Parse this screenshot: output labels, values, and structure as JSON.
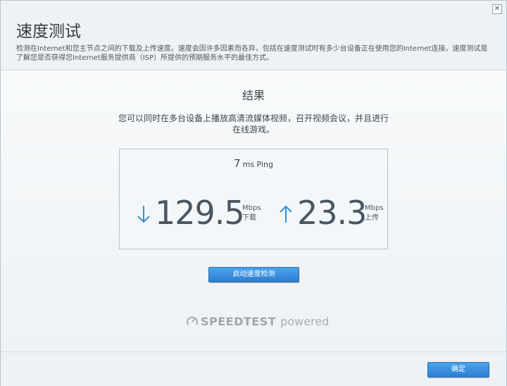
{
  "window": {
    "title": "速度测试",
    "description": "检测在Internet和您主节点之间的下载及上传速度。速度会因许多因素而各异，包括在速度测试时有多少台设备正在使用您的Internet连接。速度测试是了解您是否获得您Internet服务提供商（ISP）所提供的预期服务水平的最佳方式。",
    "close_label": "✕"
  },
  "result": {
    "title": "结果",
    "message": "您可以同时在多台设备上播放高清流媒体视频，召开视频会议，并且进行在线游戏。",
    "ping_value": "7",
    "ping_unit": "ms Ping",
    "download": {
      "value": "129.5",
      "unit": "Mbps",
      "label": "下载"
    },
    "upload": {
      "value": "23.3",
      "unit": "Mbps",
      "label": "上传"
    }
  },
  "actions": {
    "start_label": "启动速度检测",
    "ok_label": "确定"
  },
  "branding": {
    "name": "SPEEDTEST",
    "suffix": "powered"
  },
  "colors": {
    "accent": "#2d7ed0",
    "arrow": "#3a8fd9"
  }
}
